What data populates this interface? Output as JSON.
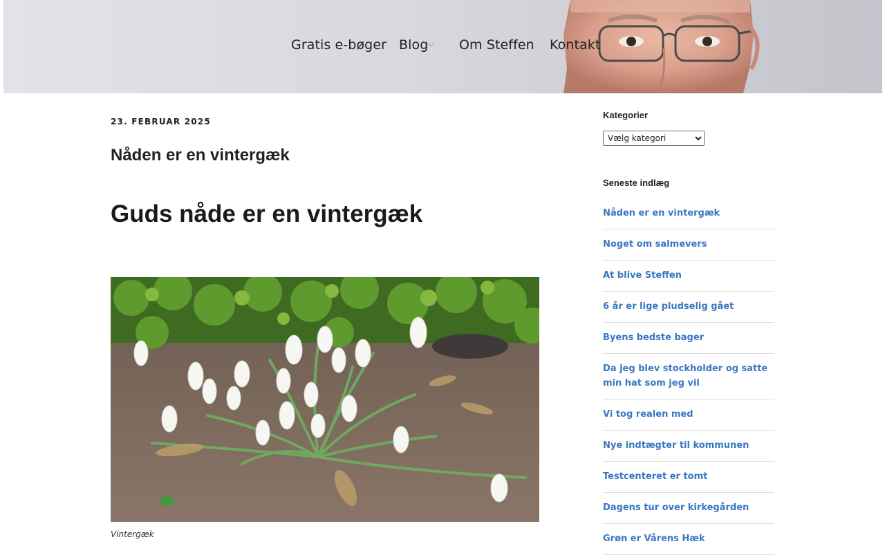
{
  "nav": {
    "items": [
      {
        "label": "Gratis e-bøger"
      },
      {
        "label": "Blog"
      },
      {
        "label": "Om Steffen"
      },
      {
        "label": "Kontakt"
      }
    ]
  },
  "post": {
    "date": "23. februar 2025",
    "title": "Nåden er en vintergæk",
    "heading": "Guds nåde er en vintergæk",
    "image_caption": "Vintergæk"
  },
  "sidebar": {
    "categories_title": "Kategorier",
    "categories_select_value": "Vælg kategori",
    "recent_title": "Seneste indlæg",
    "recent_posts": [
      {
        "label": "Nåden er en vintergæk"
      },
      {
        "label": "Noget om salmevers"
      },
      {
        "label": "At blive Steffen"
      },
      {
        "label": "6 år er lige pludselig gået"
      },
      {
        "label": "Byens bedste bager"
      },
      {
        "label": "Da jeg blev stockholder og satte min hat som jeg vil"
      },
      {
        "label": "Vi tog realen med"
      },
      {
        "label": "Nye indtægter til kommunen"
      },
      {
        "label": "Testcenteret er tomt"
      },
      {
        "label": "Dagens tur over kirkegården"
      },
      {
        "label": "Grøn er Vårens Hæk"
      }
    ]
  },
  "colors": {
    "link": "#3a77c2",
    "text": "#222222",
    "header_bg": "#d9d8df"
  }
}
